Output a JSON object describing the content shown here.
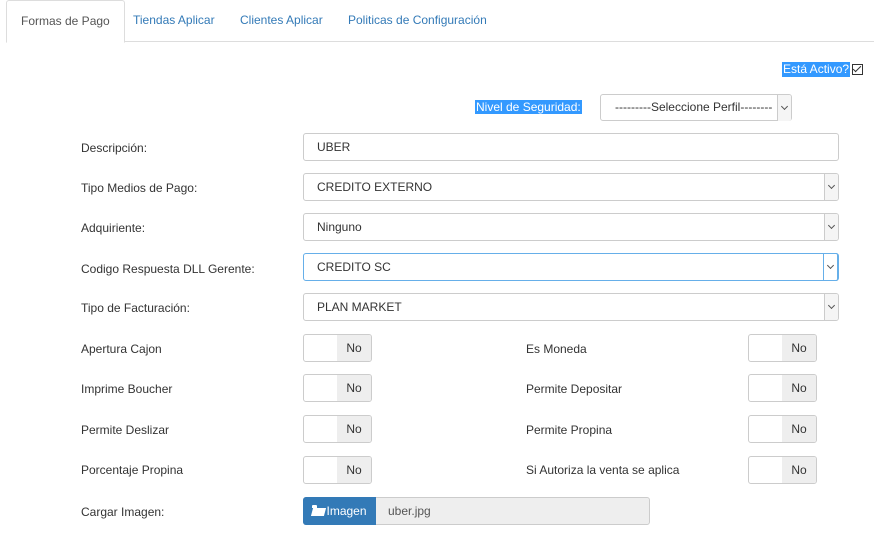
{
  "tabs": [
    {
      "label": "Formas de Pago",
      "active": true
    },
    {
      "label": "Tiendas Aplicar",
      "active": false
    },
    {
      "label": "Clientes Aplicar",
      "active": false
    },
    {
      "label": "Politicas de Configuración",
      "active": false
    }
  ],
  "active": {
    "label": "Está Activo?",
    "checked": true
  },
  "security": {
    "label": "Nivel de Seguridad:",
    "selected": "---------Seleccione Perfil--------"
  },
  "form": {
    "descripcion": {
      "label": "Descripción:",
      "value": "UBER"
    },
    "tipo_medios": {
      "label": "Tipo Medios de Pago:",
      "value": "CREDITO EXTERNO"
    },
    "adquiriente": {
      "label": "Adquiriente:",
      "value": "Ninguno"
    },
    "codigo_respuesta": {
      "label": "Codigo Respuesta DLL Gerente:",
      "value": "CREDITO SC"
    },
    "tipo_facturacion": {
      "label": "Tipo de Facturación:",
      "value": "PLAN MARKET"
    }
  },
  "toggles": {
    "apertura_cajon": {
      "label": "Apertura Cajon",
      "value": "No"
    },
    "es_moneda": {
      "label": "Es Moneda",
      "value": "No"
    },
    "imprime_boucher": {
      "label": "Imprime Boucher",
      "value": "No"
    },
    "permite_depositar": {
      "label": "Permite Depositar",
      "value": "No"
    },
    "permite_deslizar": {
      "label": "Permite Deslizar",
      "value": "No"
    },
    "permite_propina": {
      "label": "Permite Propina",
      "value": "No"
    },
    "porcentaje_propina": {
      "label": "Porcentaje Propina",
      "value": "No"
    },
    "si_autoriza": {
      "label": "Si Autoriza la venta se aplica",
      "value": "No"
    }
  },
  "upload": {
    "label": "Cargar Imagen:",
    "button_label": "Imagen",
    "filename": "uber.jpg",
    "icon": "folder-open-icon"
  },
  "colors": {
    "accent": "#337ab7",
    "selection": "#3399ff",
    "focus": "#66afe9"
  }
}
